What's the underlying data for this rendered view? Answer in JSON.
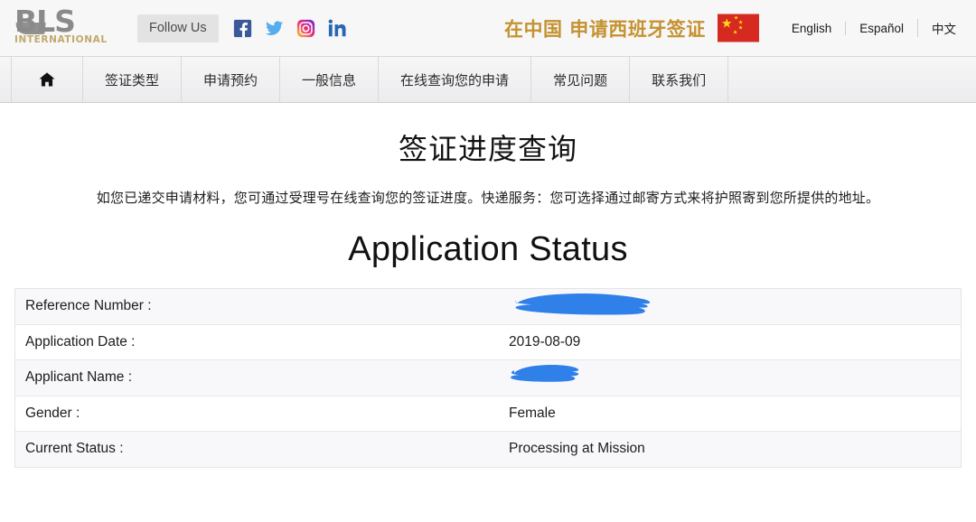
{
  "header": {
    "logo": {
      "primary": "BLS",
      "secondary": "INTERNATIONAL",
      "icon": "bls-logo"
    },
    "follow_us_label": "Follow Us",
    "socials": [
      {
        "name": "facebook-icon",
        "label": "Facebook",
        "color": "#3b5998"
      },
      {
        "name": "twitter-icon",
        "label": "Twitter",
        "color": "#55acee"
      },
      {
        "name": "instagram-icon",
        "label": "Instagram",
        "color": "#d6249f"
      },
      {
        "name": "linkedin-icon",
        "label": "LinkedIn",
        "color": "#2867b2"
      }
    ],
    "banner_text": "在中国 申请西班牙签证",
    "flag": {
      "name": "china-flag-icon",
      "background": "#d62a21",
      "star_color": "#ffde17"
    },
    "languages": [
      {
        "label": "English"
      },
      {
        "label": "Español"
      },
      {
        "label": "中文"
      }
    ]
  },
  "nav": {
    "home_icon": "home-icon",
    "items": [
      {
        "label": "签证类型"
      },
      {
        "label": "申请预约"
      },
      {
        "label": "一般信息"
      },
      {
        "label": "在线查询您的申请"
      },
      {
        "label": "常见问题"
      },
      {
        "label": "联系我们"
      }
    ]
  },
  "main": {
    "page_title": "签证进度查询",
    "page_description": "如您已递交申请材料，您可通过受理号在线查询您的签证进度。快递服务：您可选择通过邮寄方式来将护照寄到您所提供的地址。",
    "status_title": "Application Status",
    "redaction_color": "#2f80e8",
    "rows": [
      {
        "label": "Reference Number :",
        "value": "",
        "redacted": true,
        "redaction_width": 165
      },
      {
        "label": "Application Date :",
        "value": "2019-08-09",
        "redacted": false
      },
      {
        "label": "Applicant Name :",
        "value": "",
        "redacted": true,
        "redaction_width": 84
      },
      {
        "label": "Gender :",
        "value": "Female",
        "redacted": false
      },
      {
        "label": "Current Status :",
        "value": "Processing at Mission",
        "redacted": false
      }
    ]
  }
}
